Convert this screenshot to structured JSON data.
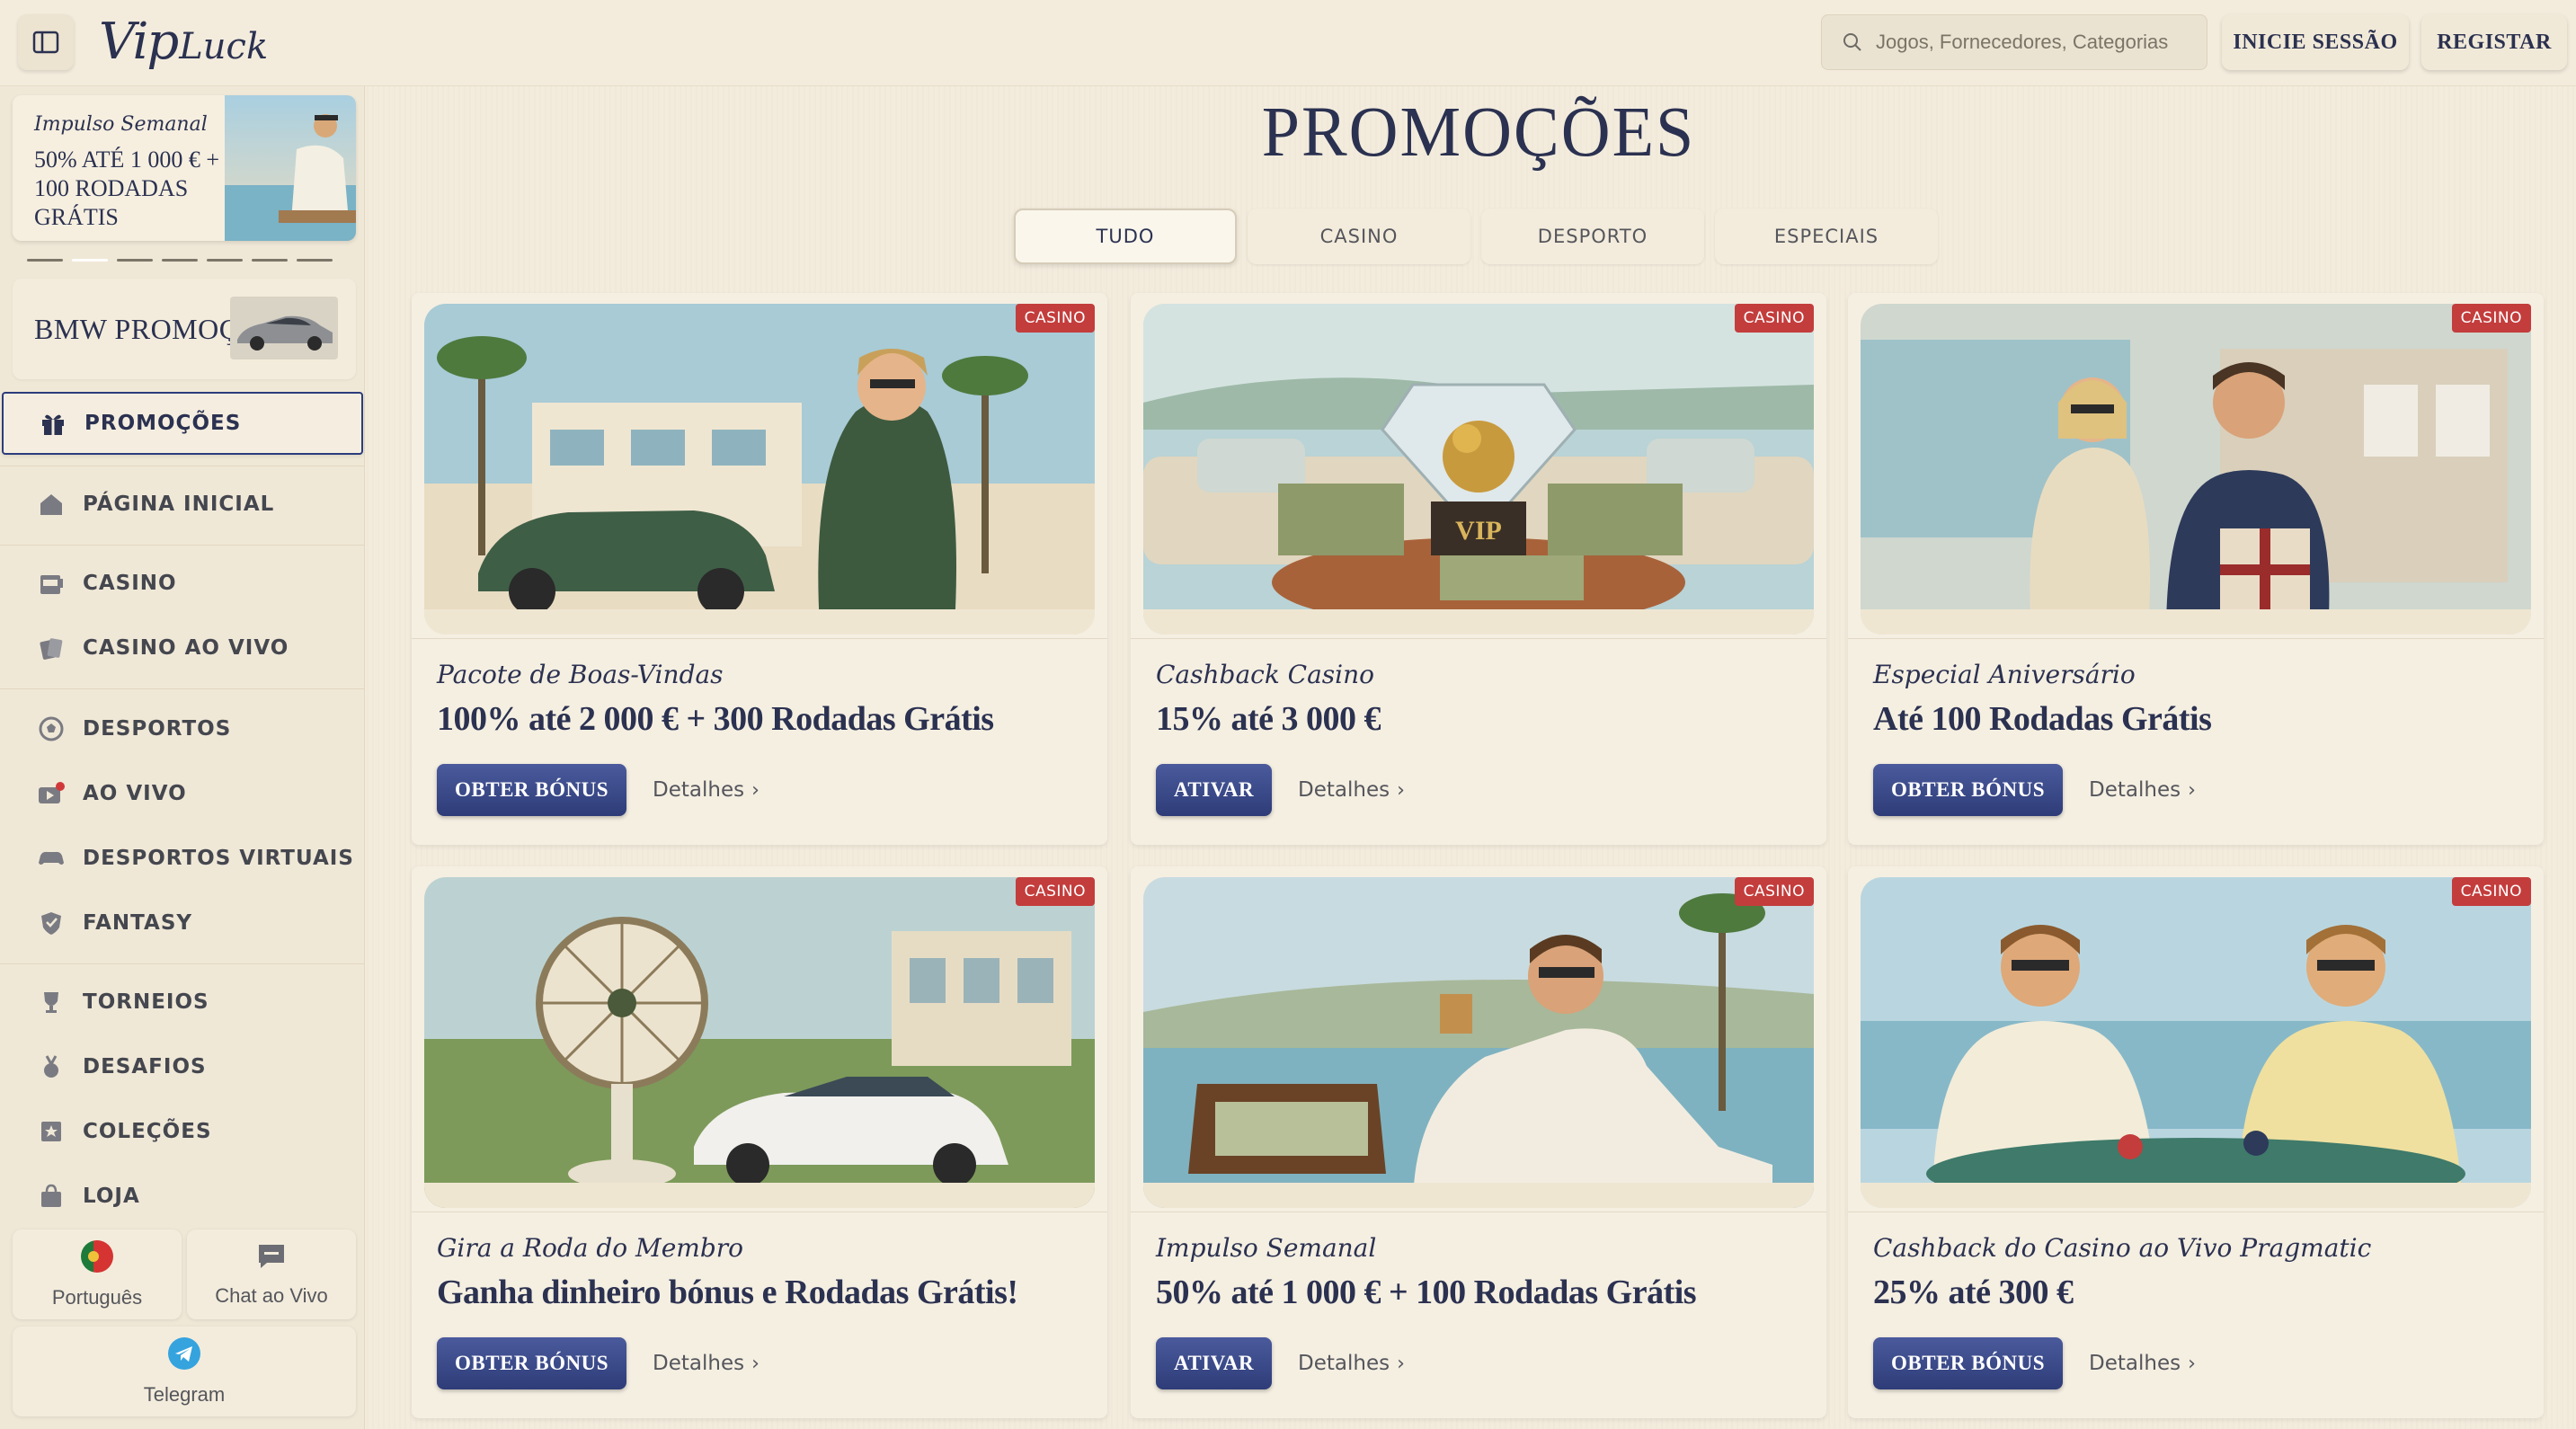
{
  "header": {
    "logo_vip": "Vip",
    "logo_luck": "Luck",
    "search_placeholder": "Jogos, Fornecedores, Categorias",
    "login_label": "INICIE SESSÃO",
    "register_label": "REGISTAR"
  },
  "sidebar": {
    "promo_banner": {
      "script": "Impulso Semanal",
      "text": "50% ATÉ 1 000 € + 100 RODADAS GRÁTIS"
    },
    "bmw_label": "BMW PROMOÇÃO",
    "nav": [
      {
        "label": "PROMOÇÕES",
        "icon": "gift-icon"
      },
      {
        "label": "PÁGINA INICIAL",
        "icon": "home-icon"
      },
      {
        "label": "CASINO",
        "icon": "slot-machine-icon"
      },
      {
        "label": "CASINO AO VIVO",
        "icon": "cards-icon"
      },
      {
        "label": "DESPORTOS",
        "icon": "soccer-ball-icon"
      },
      {
        "label": "AO VIVO",
        "icon": "live-tv-icon"
      },
      {
        "label": "DESPORTOS VIRTUAIS",
        "icon": "gamepad-icon"
      },
      {
        "label": "FANTASY",
        "icon": "shield-icon"
      },
      {
        "label": "TORNEIOS",
        "icon": "trophy-icon"
      },
      {
        "label": "DESAFIOS",
        "icon": "medal-icon"
      },
      {
        "label": "COLEÇÕES",
        "icon": "collection-icon"
      },
      {
        "label": "LOJA",
        "icon": "shop-bag-icon"
      }
    ],
    "language_label": "Português",
    "chat_label": "Chat ao Vivo",
    "telegram_label": "Telegram"
  },
  "main": {
    "title": "PROMOÇÕES",
    "tabs": [
      "TUDO",
      "CASINO",
      "DESPORTO",
      "ESPECIAIS"
    ],
    "active_tab": "TUDO",
    "details_label": "Detalhes",
    "cards": [
      {
        "badge": "CASINO",
        "subtitle": "Pacote de Boas-Vindas",
        "headline": "100% até 2 000 € + 300 Rodadas Grátis",
        "cta": "OBTER BÓNUS"
      },
      {
        "badge": "CASINO",
        "subtitle": "Cashback Casino",
        "headline": "15% até 3 000 €",
        "cta": "ATIVAR"
      },
      {
        "badge": "CASINO",
        "subtitle": "Especial Aniversário",
        "headline": "Até 100 Rodadas Grátis",
        "cta": "OBTER BÓNUS"
      },
      {
        "badge": "CASINO",
        "subtitle": "Gira a Roda do Membro",
        "headline": "Ganha dinheiro bónus e Rodadas Grátis!",
        "cta": "OBTER BÓNUS"
      },
      {
        "badge": "CASINO",
        "subtitle": "Impulso Semanal",
        "headline": "50% até 1 000 € + 100 Rodadas Grátis",
        "cta": "ATIVAR"
      },
      {
        "badge": "CASINO",
        "subtitle": "Cashback do Casino ao Vivo Pragmatic",
        "headline": "25% até 300 €",
        "cta": "OBTER BÓNUS"
      }
    ]
  },
  "colors": {
    "navy": "#2b3150",
    "badge_red": "#c33d3c",
    "button_blue": "#3a4a8a",
    "background": "#f3ecdd"
  }
}
